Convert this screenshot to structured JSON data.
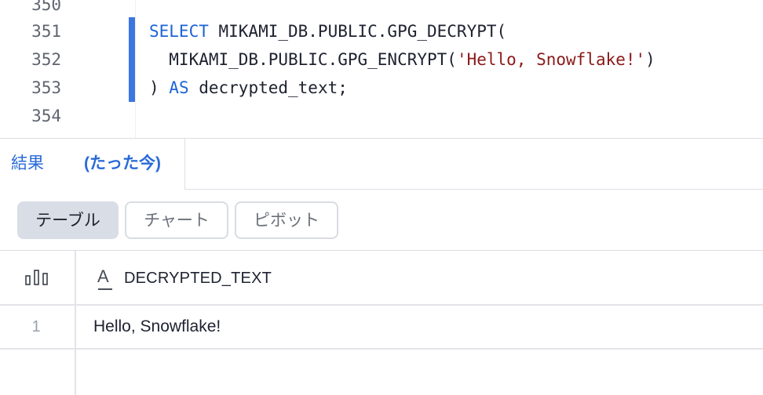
{
  "editor": {
    "lines": [
      {
        "number": "350",
        "tokens": []
      },
      {
        "number": "351",
        "marked": true,
        "tokens": [
          {
            "t": "SELECT",
            "cls": "kw"
          },
          {
            "t": " MIKAMI_DB.PUBLIC.GPG_DECRYPT(",
            "cls": ""
          }
        ]
      },
      {
        "number": "352",
        "marked": true,
        "tokens": [
          {
            "t": "  MIKAMI_DB.PUBLIC.GPG_ENCRYPT(",
            "cls": ""
          },
          {
            "t": "'Hello, Snowflake!'",
            "cls": "str"
          },
          {
            "t": ")",
            "cls": ""
          }
        ]
      },
      {
        "number": "353",
        "marked": true,
        "tokens": [
          {
            "t": ") ",
            "cls": ""
          },
          {
            "t": "AS",
            "cls": "kw"
          },
          {
            "t": " decrypted_text;",
            "cls": ""
          }
        ]
      },
      {
        "number": "354",
        "tokens": []
      }
    ]
  },
  "results": {
    "tab_label": "結果",
    "tab_time": "(たった今)",
    "views": {
      "table": "テーブル",
      "chart": "チャート",
      "pivot": "ピボット"
    },
    "columns": [
      {
        "name": "DECRYPTED_TEXT",
        "type_icon": "A"
      }
    ],
    "rows": [
      {
        "index": "1",
        "values": [
          "Hello, Snowflake!"
        ]
      }
    ]
  },
  "colors": {
    "accent": "#3b76e1",
    "keyword": "#1d63d8",
    "string": "#8b1a1a"
  }
}
